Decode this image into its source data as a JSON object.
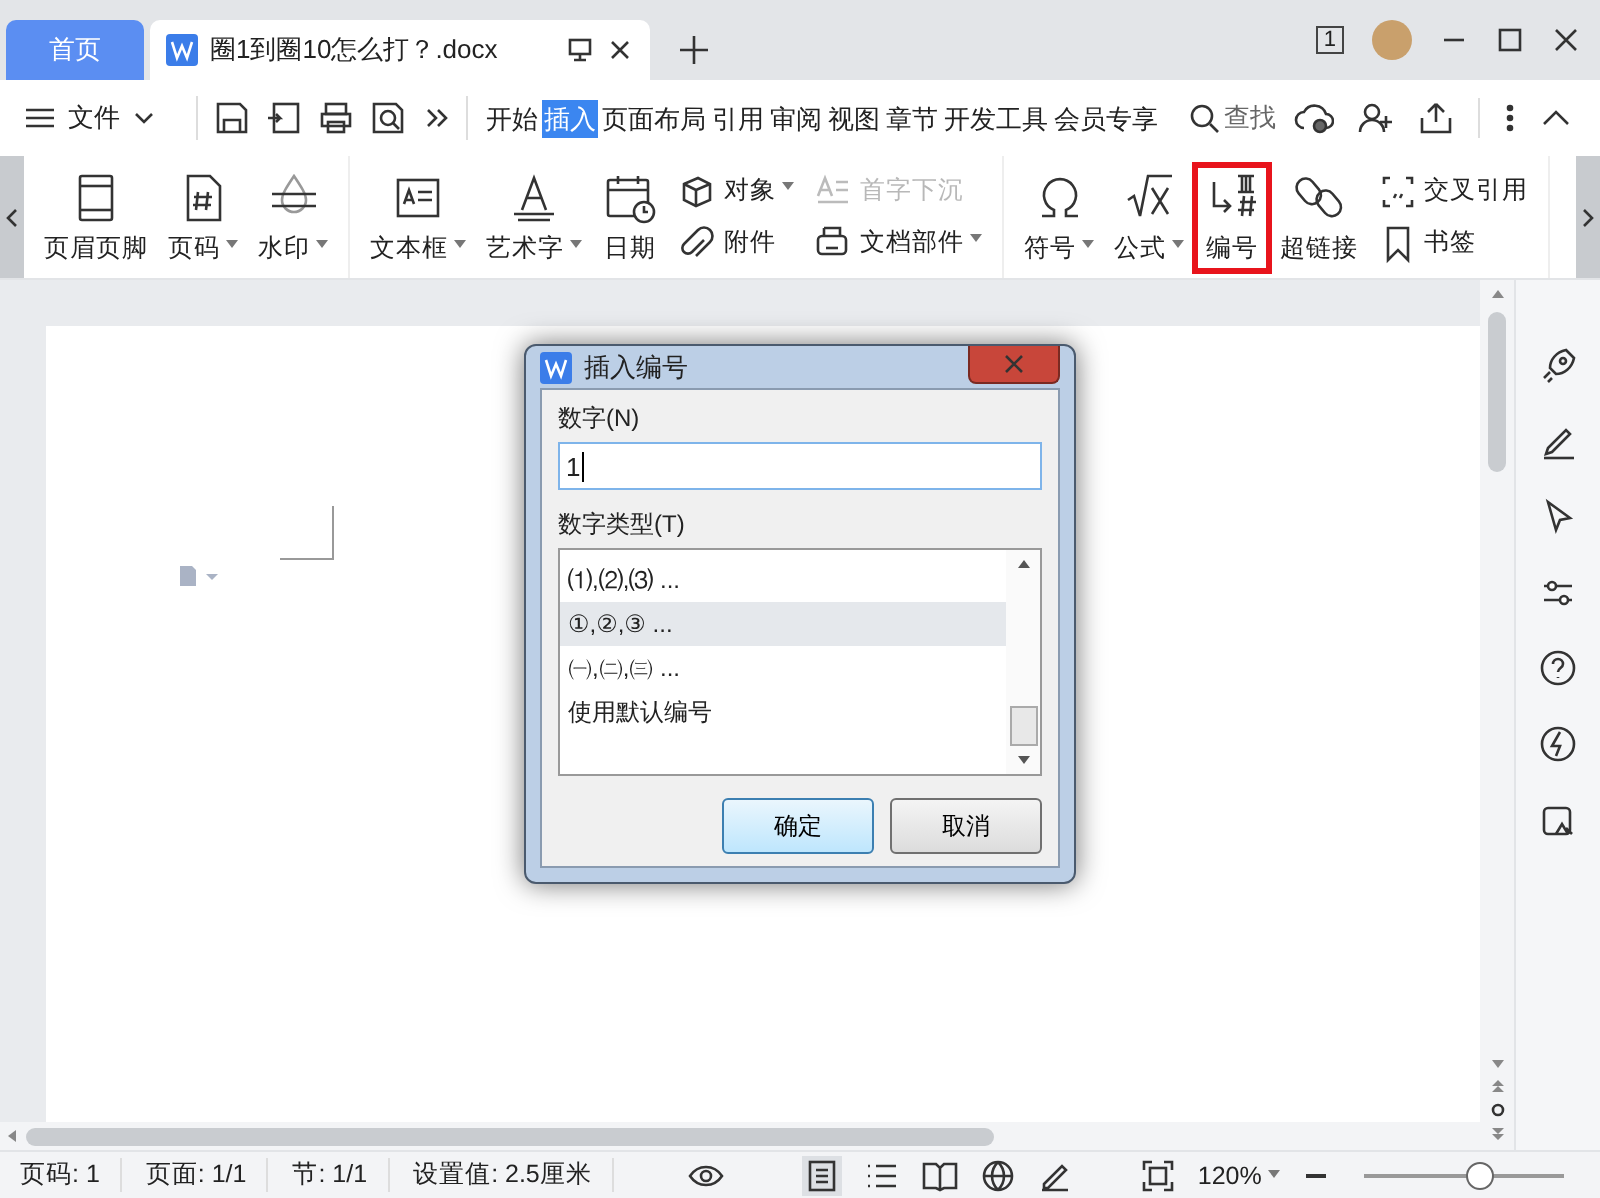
{
  "tabs": [
    {
      "label": "首页",
      "kind": "home",
      "selected": false
    },
    {
      "label": "圈1到圈10怎么打？.docx",
      "kind": "doc",
      "selected": true
    }
  ],
  "title_bar": {
    "window_count": "1"
  },
  "menu": {
    "file": "文件",
    "search": "查找",
    "items": [
      {
        "label": "开始",
        "selected": false
      },
      {
        "label": "插入",
        "selected": true
      },
      {
        "label": "页面布局",
        "selected": false
      },
      {
        "label": "引用",
        "selected": false
      },
      {
        "label": "审阅",
        "selected": false
      },
      {
        "label": "视图",
        "selected": false
      },
      {
        "label": "章节",
        "selected": false
      },
      {
        "label": "开发工具",
        "selected": false
      },
      {
        "label": "会员专享",
        "selected": false
      }
    ]
  },
  "ribbon": {
    "groups": [
      [
        {
          "kind": "large",
          "label": "页眉页脚",
          "dropdown": false,
          "highlighted": false
        },
        {
          "kind": "large",
          "label": "页码",
          "dropdown": true,
          "highlighted": false
        },
        {
          "kind": "large",
          "label": "水印",
          "dropdown": true,
          "highlighted": false
        }
      ],
      [
        {
          "kind": "large",
          "label": "文本框",
          "dropdown": true,
          "highlighted": false
        },
        {
          "kind": "large",
          "label": "艺术字",
          "dropdown": true,
          "highlighted": false
        },
        {
          "kind": "large",
          "label": "日期",
          "dropdown": false,
          "highlighted": false
        },
        {
          "kind": "small",
          "items": [
            {
              "label": "对象",
              "dropdown": true,
              "disabled": false
            },
            {
              "label": "附件",
              "dropdown": false,
              "disabled": false
            }
          ]
        },
        {
          "kind": "small",
          "items": [
            {
              "label": "首字下沉",
              "dropdown": false,
              "disabled": true
            },
            {
              "label": "文档部件",
              "dropdown": true,
              "disabled": false
            }
          ]
        }
      ],
      [
        {
          "kind": "large",
          "label": "符号",
          "dropdown": true,
          "highlighted": false
        },
        {
          "kind": "large",
          "label": "公式",
          "dropdown": true,
          "highlighted": false
        },
        {
          "kind": "large",
          "label": "编号",
          "dropdown": false,
          "highlighted": true
        },
        {
          "kind": "large",
          "label": "超链接",
          "dropdown": false,
          "highlighted": false
        },
        {
          "kind": "small",
          "items": [
            {
              "label": "交叉引用",
              "dropdown": false,
              "disabled": false
            },
            {
              "label": "书签",
              "dropdown": false,
              "disabled": false
            }
          ]
        }
      ]
    ]
  },
  "dialog": {
    "title": "插入编号",
    "number_label": "数字(N)",
    "number_value": "1",
    "type_label": "数字类型(T)",
    "types": [
      {
        "label": "⑴,⑵,⑶ ...",
        "selected": false
      },
      {
        "label": "①,②,③ ...",
        "selected": true
      },
      {
        "label": "㈠,㈡,㈢ ...",
        "selected": false
      },
      {
        "label": "使用默认编号",
        "selected": false
      }
    ],
    "ok": "确定",
    "cancel": "取消"
  },
  "status_bar": {
    "items": [
      "页码: 1",
      "页面: 1/1",
      "节: 1/1",
      "设置值: 2.5厘米"
    ],
    "zoom": "120%",
    "zoom_slider": {
      "level": 0.6
    }
  }
}
